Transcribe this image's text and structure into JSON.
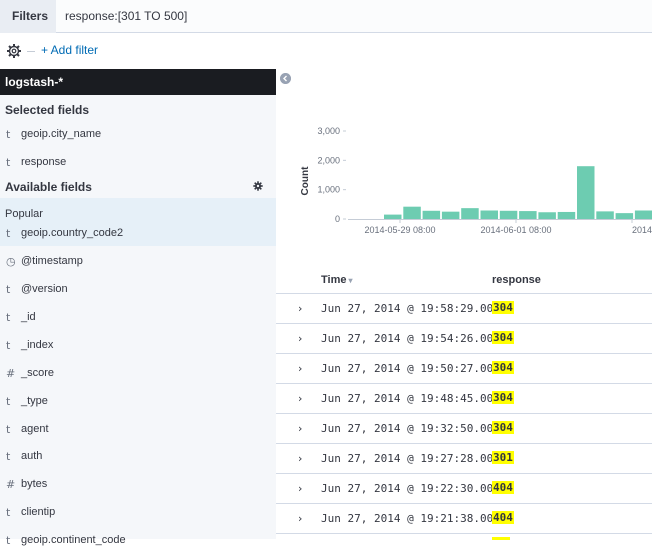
{
  "query": {
    "filters_label": "Filters",
    "value": "response:[301 TO 500]"
  },
  "filterbar": {
    "settings_icon": "gear-icon",
    "add_filter_label": "+ Add filter"
  },
  "sidebar": {
    "index_pattern": "logstash-*",
    "selected_title": "Selected fields",
    "selected_fields": [
      {
        "type": "t",
        "name": "geoip.city_name"
      },
      {
        "type": "t",
        "name": "response"
      }
    ],
    "available_title": "Available fields",
    "popular_label": "Popular",
    "popular_fields": [
      {
        "type": "t",
        "name": "geoip.country_code2"
      }
    ],
    "available_fields": [
      {
        "type": "◷",
        "name": "@timestamp"
      },
      {
        "type": "t",
        "name": "@version"
      },
      {
        "type": "t",
        "name": "_id"
      },
      {
        "type": "t",
        "name": "_index"
      },
      {
        "type": "#",
        "name": "_score"
      },
      {
        "type": "t",
        "name": "_type"
      },
      {
        "type": "t",
        "name": "agent"
      },
      {
        "type": "t",
        "name": "auth"
      },
      {
        "type": "#",
        "name": "bytes"
      },
      {
        "type": "t",
        "name": "clientip"
      },
      {
        "type": "t",
        "name": "geoip.continent_code"
      }
    ]
  },
  "table": {
    "time_header": "Time",
    "response_header": "response",
    "rows": [
      {
        "time": "Jun 27, 2014 @ 19:58:29.000",
        "response": "304"
      },
      {
        "time": "Jun 27, 2014 @ 19:54:26.000",
        "response": "304"
      },
      {
        "time": "Jun 27, 2014 @ 19:50:27.000",
        "response": "304"
      },
      {
        "time": "Jun 27, 2014 @ 19:48:45.000",
        "response": "304"
      },
      {
        "time": "Jun 27, 2014 @ 19:32:50.000",
        "response": "304"
      },
      {
        "time": "Jun 27, 2014 @ 19:27:28.000",
        "response": "301"
      },
      {
        "time": "Jun 27, 2014 @ 19:22:30.000",
        "response": "404"
      },
      {
        "time": "Jun 27, 2014 @ 19:21:38.000",
        "response": "404"
      }
    ]
  },
  "chart_data": {
    "type": "bar",
    "ylabel": "Count",
    "ylim": [
      0,
      3000
    ],
    "yticks": [
      "0",
      "1,000",
      "2,000",
      "3,000"
    ],
    "xticks": [
      "2014-05-29 08:00",
      "2014-06-01 08:00",
      "2014-"
    ],
    "values": [
      150,
      420,
      280,
      250,
      370,
      290,
      280,
      270,
      230,
      240,
      1800,
      260,
      200,
      290
    ],
    "bar_color": "#6dccb1"
  },
  "colors": {
    "accent": "#006bb4",
    "highlight": "#ffff00",
    "index_bg": "#1a1c21"
  }
}
